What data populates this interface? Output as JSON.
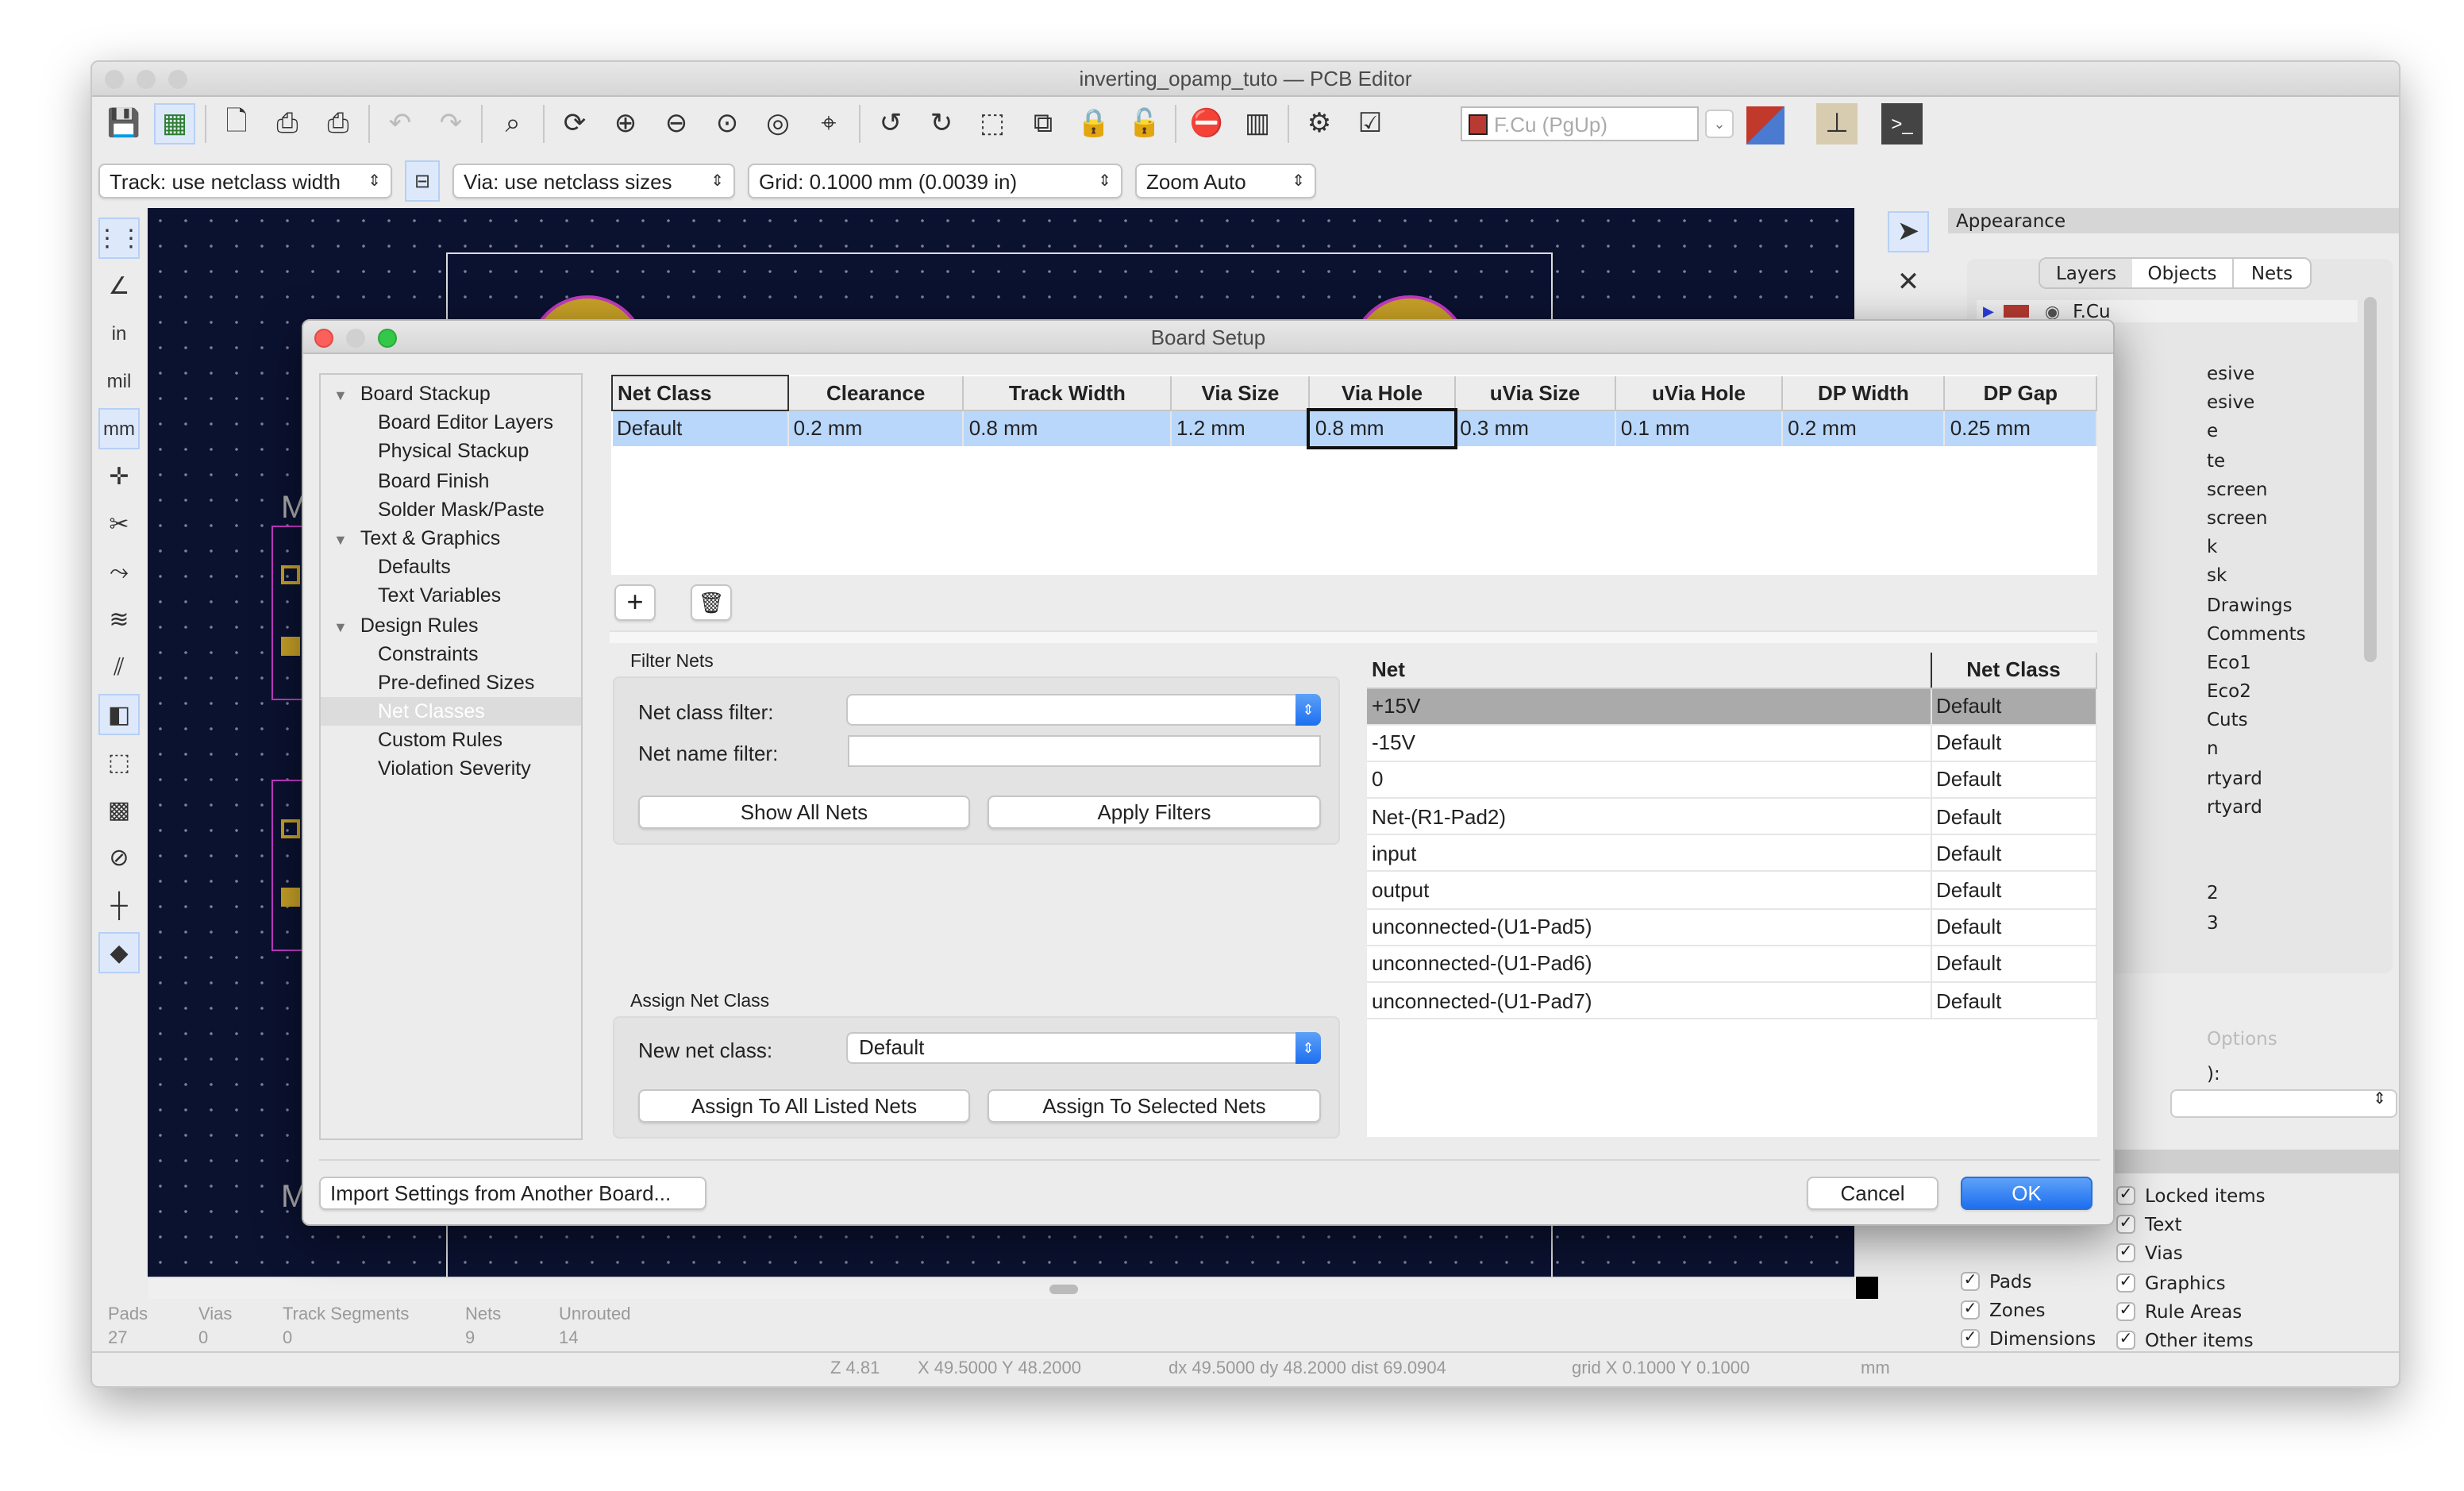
{
  "window": {
    "title": "inverting_opamp_tuto — PCB Editor"
  },
  "toolbar": {
    "icons": [
      "save-icon",
      "board-setup-icon",
      "page-settings-icon",
      "print-icon",
      "plot-icon",
      "undo-icon",
      "redo-icon",
      "find-icon",
      "redraw-icon",
      "zoom-in-icon",
      "zoom-out-icon",
      "zoom-fit-icon",
      "zoom-objects-icon",
      "zoom-selection-icon",
      "rotate-ccw-icon",
      "rotate-cw-icon",
      "group-icon",
      "ungroup-icon",
      "lock-icon",
      "unlock-icon",
      "netlist-icon",
      "footprint-editor-icon",
      "scripting-icon",
      "drc-icon"
    ],
    "layer_select": "F.Cu (PgUp)",
    "layer_color": "#b83a32",
    "track": "Track: use netclass width",
    "via": "Via: use netclass sizes",
    "grid": "Grid: 0.1000 mm (0.0039 in)",
    "zoom": "Zoom Auto"
  },
  "left_tools": [
    "grid-icon",
    "polar-icon",
    "inch-icon",
    "mil-icon",
    "mm-icon",
    "cursor-icon",
    "ratsnest-icon",
    "curved-ratsnest-icon",
    "track-highlight-icon",
    "hidden-tracks-icon",
    "zone-fill-icon",
    "zone-outline-icon",
    "drc-markers-icon",
    "via-icon",
    "microwave-icon",
    "layers-icon"
  ],
  "left_tool_labels": {
    "inch": "in",
    "mil": "mil",
    "mm": "mm"
  },
  "canvas": {
    "labels": [
      "M",
      "M"
    ]
  },
  "appearance": {
    "title": "Appearance",
    "tabs": [
      "Layers",
      "Objects",
      "Nets"
    ],
    "first_layer": "F.Cu",
    "layer_fragments": [
      "esive",
      "esive",
      "e",
      "te",
      "screen",
      "screen",
      "k",
      "sk",
      "Drawings",
      "Comments",
      "Eco1",
      "Eco2",
      "Cuts",
      "n",
      "rtyard",
      "rtyard",
      "",
      "",
      "2",
      "3"
    ],
    "options_fragment": "Options",
    "preset_fragment": "):",
    "objects_left": [
      "Pads",
      "Zones",
      "Dimensions"
    ],
    "objects_right": [
      "Locked items",
      "Text",
      "Vias",
      "Graphics",
      "Rule Areas",
      "Other items"
    ]
  },
  "stats": {
    "labels": [
      "Pads",
      "Vias",
      "Track Segments",
      "Nets",
      "Unrouted"
    ],
    "values": [
      "27",
      "0",
      "0",
      "9",
      "14"
    ]
  },
  "statusbar": {
    "zoom": "Z 4.81",
    "pos": "X 49.5000  Y 48.2000",
    "delta": "dx 49.5000  dy 48.2000  dist 69.0904",
    "grid": "grid X 0.1000  Y 0.1000",
    "units": "mm"
  },
  "dialog": {
    "title": "Board Setup",
    "tree": [
      {
        "label": "Board Stackup",
        "level": 0
      },
      {
        "label": "Board Editor Layers",
        "level": 1
      },
      {
        "label": "Physical Stackup",
        "level": 1
      },
      {
        "label": "Board Finish",
        "level": 1
      },
      {
        "label": "Solder Mask/Paste",
        "level": 1
      },
      {
        "label": "Text & Graphics",
        "level": 0
      },
      {
        "label": "Defaults",
        "level": 1
      },
      {
        "label": "Text Variables",
        "level": 1
      },
      {
        "label": "Design Rules",
        "level": 0
      },
      {
        "label": "Constraints",
        "level": 1
      },
      {
        "label": "Pre-defined Sizes",
        "level": 1
      },
      {
        "label": "Net Classes",
        "level": 1,
        "selected": true
      },
      {
        "label": "Custom Rules",
        "level": 1
      },
      {
        "label": "Violation Severity",
        "level": 1
      }
    ],
    "netclass_table": {
      "columns": [
        "Net Class",
        "Clearance",
        "Track Width",
        "Via Size",
        "Via Hole",
        "uVia Size",
        "uVia Hole",
        "DP Width",
        "DP Gap"
      ],
      "rows": [
        [
          "Default",
          "0.2 mm",
          "0.8 mm",
          "1.2 mm",
          "0.8 mm",
          "0.3 mm",
          "0.1 mm",
          "0.2 mm",
          "0.25 mm"
        ]
      ]
    },
    "filter": {
      "title": "Filter Nets",
      "class_label": "Net class filter:",
      "class_value": "",
      "name_label": "Net name filter:",
      "name_value": "",
      "show_all": "Show All Nets",
      "apply": "Apply Filters"
    },
    "assign": {
      "title": "Assign Net Class",
      "label": "New net class:",
      "value": "Default",
      "all": "Assign To All Listed Nets",
      "selected": "Assign To Selected Nets"
    },
    "nets_table": {
      "columns": [
        "Net",
        "Net Class"
      ],
      "rows": [
        [
          "+15V",
          "Default"
        ],
        [
          "-15V",
          "Default"
        ],
        [
          "0",
          "Default"
        ],
        [
          "Net-(R1-Pad2)",
          "Default"
        ],
        [
          "input",
          "Default"
        ],
        [
          "output",
          "Default"
        ],
        [
          "unconnected-(U1-Pad5)",
          "Default"
        ],
        [
          "unconnected-(U1-Pad6)",
          "Default"
        ],
        [
          "unconnected-(U1-Pad7)",
          "Default"
        ]
      ]
    },
    "import": "Import Settings from Another Board...",
    "cancel": "Cancel",
    "ok": "OK"
  }
}
